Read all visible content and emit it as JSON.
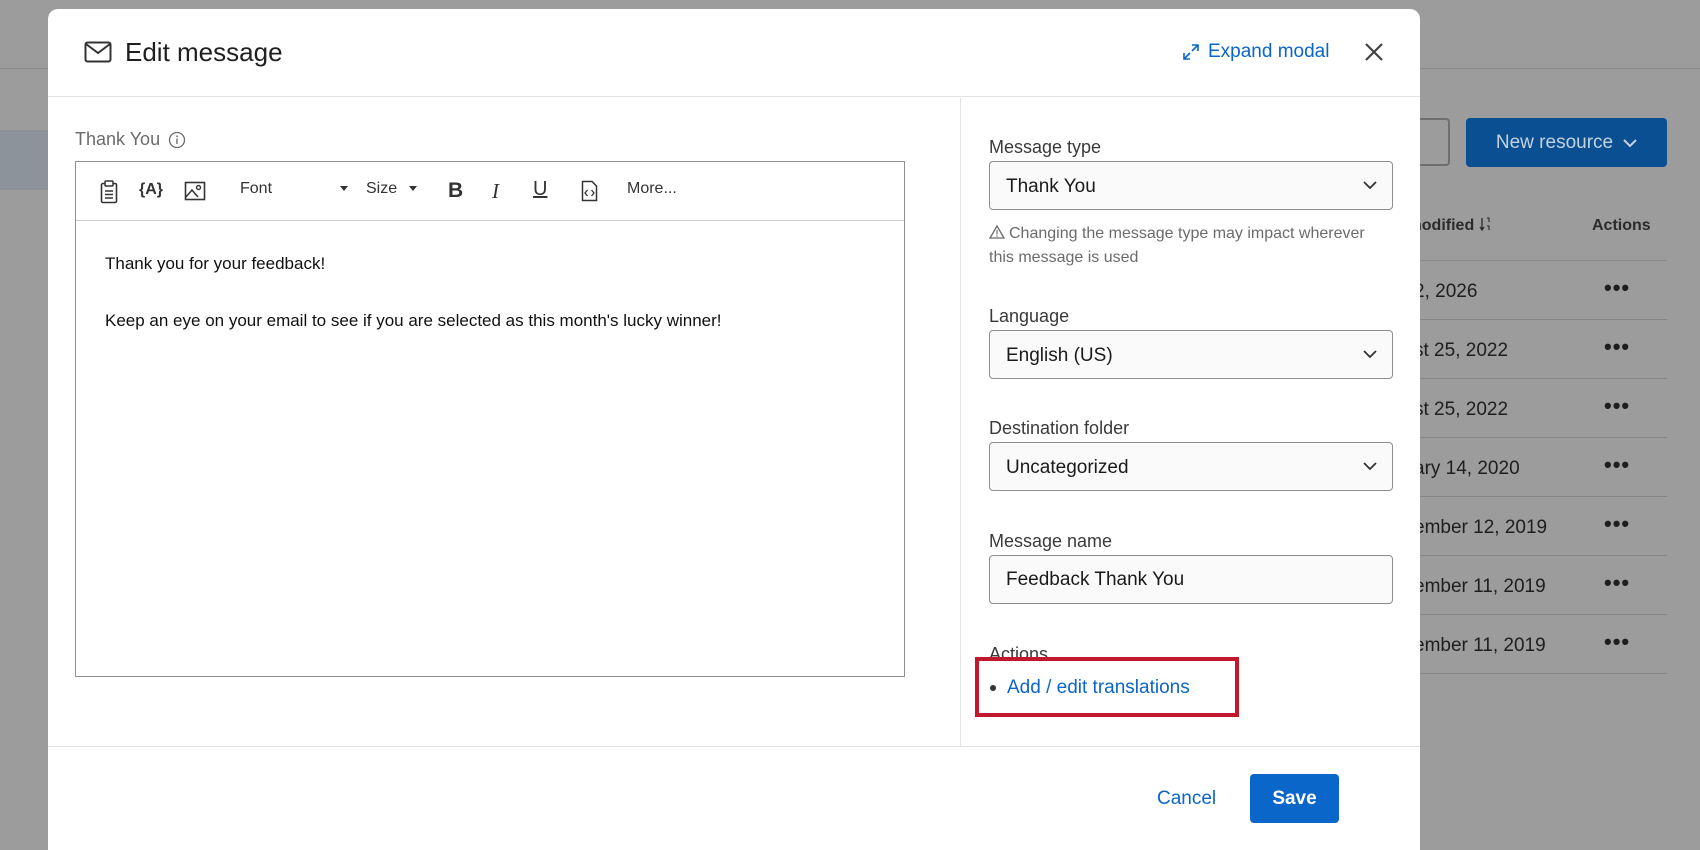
{
  "background": {
    "new_resource_label": "New resource",
    "column_modified": "nodified",
    "column_actions": "Actions",
    "rows": [
      {
        "date": "2, 2026"
      },
      {
        "date": "st 25, 2022"
      },
      {
        "date": "st 25, 2022"
      },
      {
        "date": "ary 14, 2020"
      },
      {
        "date": "ember 12, 2019"
      },
      {
        "date": "ember 11, 2019"
      },
      {
        "date": "ember 11, 2019"
      }
    ],
    "row_menu_glyph": "•••"
  },
  "modal": {
    "title": "Edit message",
    "expand_label": "Expand modal",
    "icons": {
      "title": "mail-icon",
      "expand": "expand-arrows-icon",
      "close": "close-icon"
    }
  },
  "editor": {
    "label": "Thank You",
    "toolbar": {
      "font_label": "Font",
      "size_label": "Size",
      "more_label": "More..."
    },
    "body": [
      "Thank you for your feedback!",
      "Keep an eye on your email to see if you are selected as this month's lucky winner!"
    ]
  },
  "form": {
    "message_type": {
      "label": "Message type",
      "value": "Thank You",
      "warning": "Changing the message type may impact wherever this message is used"
    },
    "language": {
      "label": "Language",
      "value": "English (US)"
    },
    "destination_folder": {
      "label": "Destination folder",
      "value": "Uncategorized"
    },
    "message_name": {
      "label": "Message name",
      "value": "Feedback Thank You"
    },
    "actions": {
      "label": "Actions",
      "translations_link": "Add / edit translations"
    }
  },
  "footer": {
    "cancel_label": "Cancel",
    "save_label": "Save"
  },
  "colors": {
    "accent": "#0b66c9",
    "highlight": "#c1182e"
  }
}
